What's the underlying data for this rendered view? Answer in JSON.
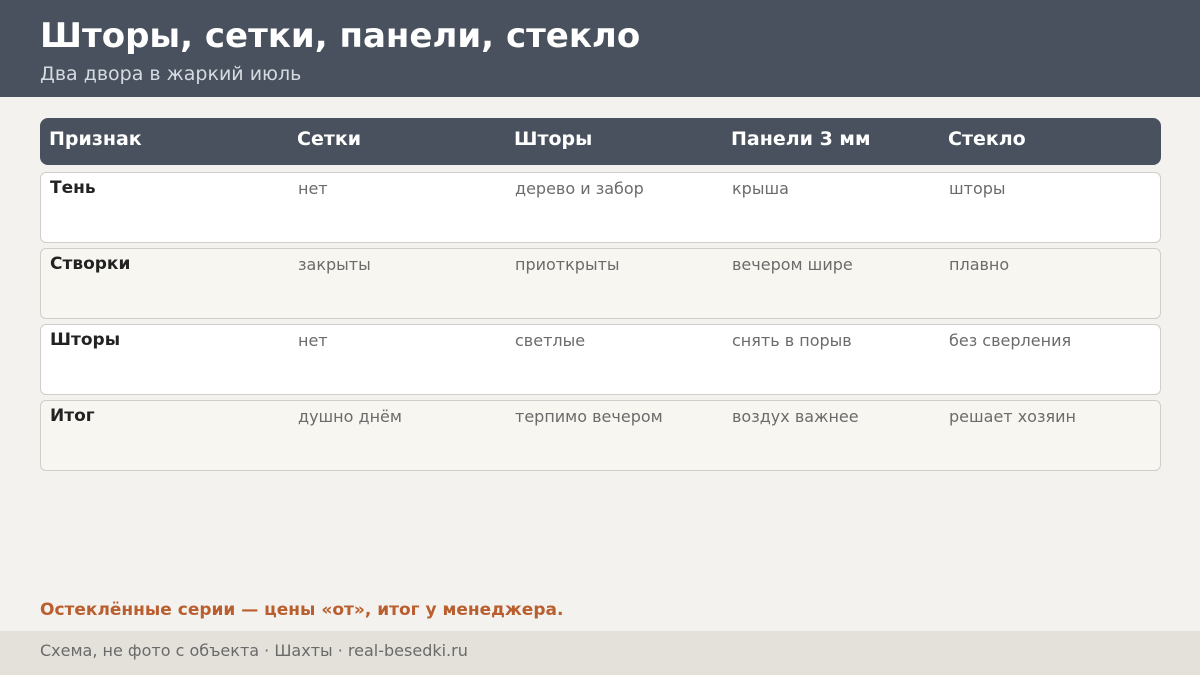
{
  "header": {
    "title": "Шторы, сетки, панели, стекло",
    "subtitle": "Два двора в жаркий июль"
  },
  "table": {
    "columns": [
      "Признак",
      "Сетки",
      "Шторы",
      "Панели 3 мм",
      "Стекло"
    ],
    "rows": [
      {
        "label": "Тень",
        "values": [
          "нет",
          "дерево и забор",
          "крыша",
          "шторы"
        ]
      },
      {
        "label": "Створки",
        "values": [
          "закрыты",
          "приоткрыты",
          "вечером шире",
          "плавно"
        ]
      },
      {
        "label": "Шторы",
        "values": [
          "нет",
          "светлые",
          "снять в порыв",
          "без сверления"
        ]
      },
      {
        "label": "Итог",
        "values": [
          "душно днём",
          "терпимо вечером",
          "воздух важнее",
          "решает хозяин"
        ]
      }
    ]
  },
  "note": "Остеклённые серии — цены «от», итог у менеджера.",
  "footer": {
    "text": "Схема, не фото с объекта  ·  Шахты  ·  real-besedki.ru"
  },
  "colors": {
    "header_bg": "#48515d",
    "page_bg": "#f4f2ee",
    "accent": "#b95e2e",
    "footer_bg": "#e4e1db"
  }
}
